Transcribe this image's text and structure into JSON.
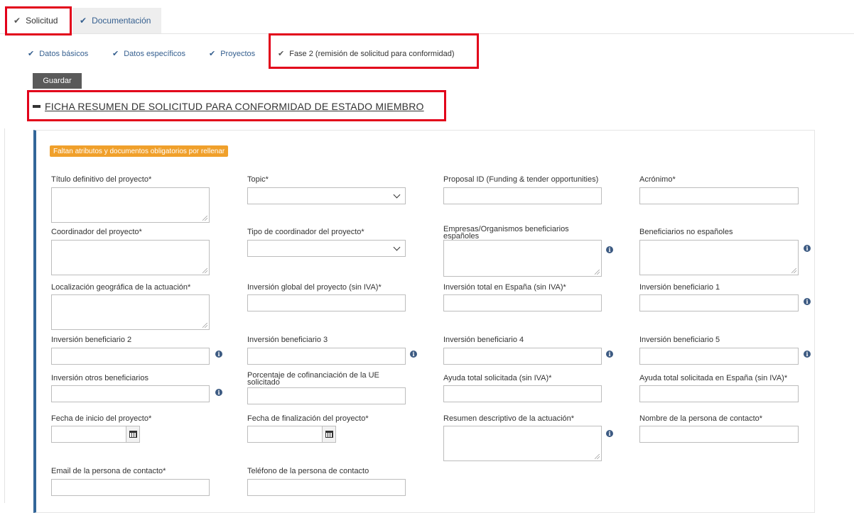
{
  "tabs": [
    {
      "label": "Solicitud"
    },
    {
      "label": "Documentación"
    }
  ],
  "steps": [
    {
      "label": "Datos básicos"
    },
    {
      "label": "Datos específicos"
    },
    {
      "label": "Proyectos"
    },
    {
      "label": "Fase 2 (remisión de solicitud para conformidad)"
    }
  ],
  "toolbar": {
    "save_label": "Guardar"
  },
  "section": {
    "title": "FICHA RESUMEN DE SOLICITUD PARA CONFORMIDAD DE ESTADO MIEMBRO"
  },
  "warning": {
    "text": "Faltan atributos y documentos obligatorios por rellenar"
  },
  "icons": {
    "check": "check-icon",
    "info": "info-icon",
    "calendar": "calendar-icon",
    "collapse": "minus-icon",
    "dropdown": "chevron-down-icon"
  },
  "colors": {
    "accent": "#336699",
    "link": "#355f8f",
    "warning": "#f0a02b",
    "highlight": "#e2001a",
    "button": "#5a5a5a"
  },
  "fields": {
    "titulo": {
      "label": "Título definitivo del proyecto*"
    },
    "topic": {
      "label": "Topic*"
    },
    "proposal": {
      "label": "Proposal ID (Funding & tender opportunities)"
    },
    "acronimo": {
      "label": "Acrónimo*"
    },
    "coordinador": {
      "label": "Coordinador del proyecto*"
    },
    "tipo_coord": {
      "label": "Tipo de coordinador del proyecto*"
    },
    "empresas": {
      "label": "Empresas/Organismos beneficiarios españoles"
    },
    "no_espanoles": {
      "label": "Beneficiarios no españoles"
    },
    "localizacion": {
      "label": "Localización geográfica de la actuación*"
    },
    "inv_global": {
      "label": "Inversión global del proyecto (sin IVA)*"
    },
    "inv_espana": {
      "label": "Inversión total en España (sin IVA)*"
    },
    "inv_b1": {
      "label": "Inversión beneficiario 1"
    },
    "inv_b2": {
      "label": "Inversión beneficiario 2"
    },
    "inv_b3": {
      "label": "Inversión beneficiario 3"
    },
    "inv_b4": {
      "label": "Inversión beneficiario 4"
    },
    "inv_b5": {
      "label": "Inversión beneficiario 5"
    },
    "inv_otros": {
      "label": "Inversión otros beneficiarios"
    },
    "cofin": {
      "label": "Porcentaje de cofinanciación de la UE solicitado"
    },
    "ayuda_total": {
      "label": "Ayuda total solicitada (sin IVA)*"
    },
    "ayuda_espana": {
      "label": "Ayuda total solicitada en España (sin IVA)*"
    },
    "fecha_inicio": {
      "label": "Fecha de inicio del proyecto*"
    },
    "fecha_fin": {
      "label": "Fecha de finalización del proyecto*"
    },
    "resumen": {
      "label": "Resumen descriptivo de la actuación*"
    },
    "contacto_nombre": {
      "label": "Nombre de la persona de contacto*"
    },
    "contacto_email": {
      "label": "Email de la persona de contacto*"
    },
    "contacto_tel": {
      "label": "Teléfono de la persona de contacto"
    }
  }
}
